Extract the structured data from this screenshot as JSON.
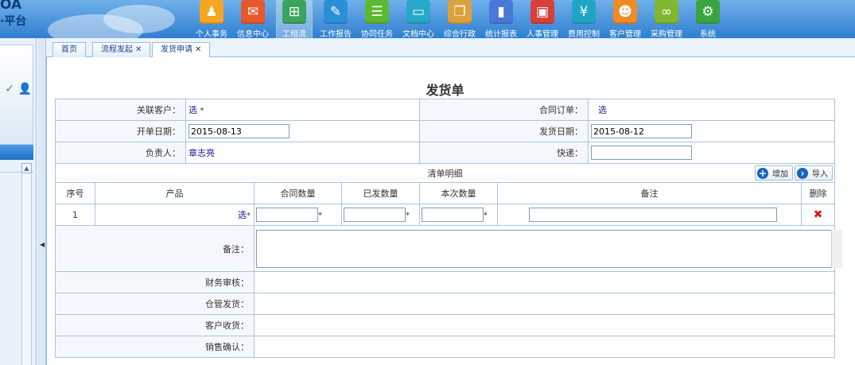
{
  "logo": {
    "line1": "OA",
    "line2": "·平台"
  },
  "nav": [
    {
      "label": "个人事务",
      "icon": "person-icon",
      "color": "#f5a623",
      "glyph": "♟"
    },
    {
      "label": "信息中心",
      "icon": "chat-icon",
      "color": "#e8572a",
      "glyph": "✉"
    },
    {
      "label": "工组流",
      "icon": "workflow-icon",
      "color": "#3ba35d",
      "glyph": "⊞",
      "active": true
    },
    {
      "label": "工作报告",
      "icon": "report-icon",
      "color": "#2b8fd8",
      "glyph": "✎"
    },
    {
      "label": "协同任务",
      "icon": "task-icon",
      "color": "#5cb82f",
      "glyph": "☰"
    },
    {
      "label": "文档中心",
      "icon": "folder-icon",
      "color": "#26a8c9",
      "glyph": "▭"
    },
    {
      "label": "综合行政",
      "icon": "admin-icon",
      "color": "#d9a23c",
      "glyph": "❐"
    },
    {
      "label": "统计报表",
      "icon": "chart-icon",
      "color": "#4a78d8",
      "glyph": "▮"
    },
    {
      "label": "人事管理",
      "icon": "hr-card-icon",
      "color": "#d6403a",
      "glyph": "▣"
    },
    {
      "label": "费用控制",
      "icon": "yen-icon",
      "color": "#21a5c7",
      "glyph": "¥"
    },
    {
      "label": "客户管理",
      "icon": "customers-icon",
      "color": "#f08a24",
      "glyph": "☻"
    },
    {
      "label": "采购管理",
      "icon": "purchase-icon",
      "color": "#7fb82e",
      "glyph": "∞"
    },
    {
      "label": "系统",
      "icon": "gear-icon",
      "color": "#3aa53f",
      "glyph": "⚙"
    }
  ],
  "tabs": [
    {
      "label": "首页",
      "closable": false
    },
    {
      "label": "流程发起",
      "closable": true
    },
    {
      "label": "发货申请",
      "closable": true,
      "active": true
    }
  ],
  "doc_title": "发货单",
  "form": {
    "customer_label": "关联客户：",
    "customer_value": "选",
    "contract_label": "合同订单：",
    "contract_value": "选",
    "open_date_label": "开单日期：",
    "open_date_value": "2015-08-13",
    "ship_date_label": "发货日期：",
    "ship_date_value": "2015-08-12",
    "owner_label": "负责人：",
    "owner_value": "章志亮",
    "express_label": "快递：",
    "express_value": "",
    "list_title": "清单明细",
    "add_label": "增加",
    "import_label": "导入",
    "columns": [
      "序号",
      "产品",
      "合同数量",
      "已发数量",
      "本次数量",
      "备注",
      "删除"
    ],
    "row_index": "1",
    "row_product": "选",
    "remark_label": "备注：",
    "finance_label": "财务审核：",
    "warehouse_label": "仓管发货：",
    "receive_label": "客户收货：",
    "sales_label": "销售确认："
  }
}
